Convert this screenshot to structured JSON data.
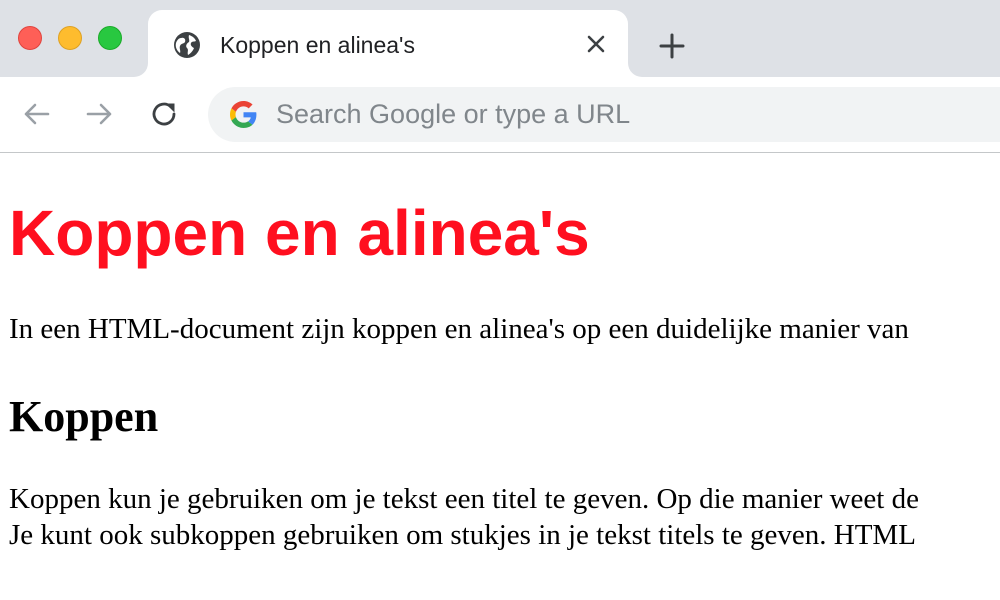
{
  "browser": {
    "tab": {
      "title": "Koppen en alinea's",
      "favicon": "globe-icon",
      "close_icon": "close-icon"
    },
    "new_tab_icon": "plus-icon",
    "toolbar": {
      "back_icon": "arrow-left-icon",
      "forward_icon": "arrow-right-icon",
      "reload_icon": "reload-icon"
    },
    "omnibox": {
      "icon": "google-g-icon",
      "placeholder": "Search Google or type a URL"
    },
    "colors": {
      "tabstrip": "#dee1e6",
      "omnibox": "#f1f3f4",
      "traffic_red": "#fe5f57",
      "traffic_yellow": "#febc2e",
      "traffic_green": "#28c840"
    }
  },
  "page": {
    "heading": "Koppen en alinea's",
    "heading_color": "#ff0f1f",
    "intro": "In een HTML-document zijn koppen en alinea's op een duidelijke manier van",
    "subheading": "Koppen",
    "paragraph_lines": [
      "Koppen kun je gebruiken om je tekst een titel te geven. Op die manier weet de",
      "Je kunt ook subkoppen gebruiken om stukjes in je tekst titels te geven. HTML"
    ]
  }
}
